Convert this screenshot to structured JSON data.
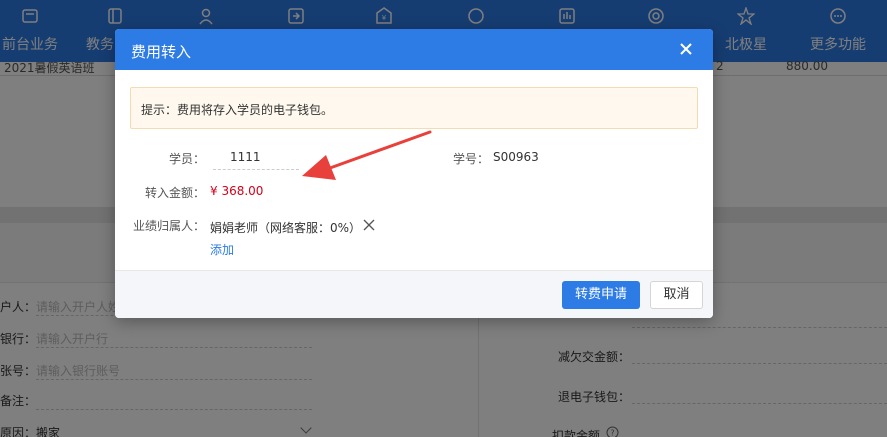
{
  "nav": {
    "items": [
      {
        "label": "前台业务",
        "icon": "front-desk-icon"
      },
      {
        "label": "教务",
        "icon": "book-icon"
      },
      {
        "label": "",
        "icon": "user-icon"
      },
      {
        "label": "",
        "icon": "login-icon"
      },
      {
        "label": "",
        "icon": "finance-icon"
      },
      {
        "label": "",
        "icon": "chat-icon"
      },
      {
        "label": "",
        "icon": "chart-icon"
      },
      {
        "label": "",
        "icon": "target-icon"
      },
      {
        "label": "北极星",
        "icon": "star-icon"
      },
      {
        "label": "更多功能",
        "icon": "more-icon"
      }
    ]
  },
  "background": {
    "class_name": "2021暑假英语班",
    "col_value": "2",
    "amount": "880.00",
    "left_form": [
      {
        "label": "户人：",
        "placeholder": "请输入开户人姓名"
      },
      {
        "label": "银行：",
        "placeholder": "请输入开户行"
      },
      {
        "label": "张号：",
        "placeholder": "请输入银行账号"
      },
      {
        "label": "备注：",
        "placeholder": ""
      },
      {
        "label": "原因：",
        "value": "搬家"
      }
    ],
    "right_form": [
      {
        "label": "减欠交金额："
      },
      {
        "label": "退电子钱包："
      },
      {
        "label": "扣款金额"
      }
    ]
  },
  "modal": {
    "title": "费用转入",
    "tip": "提示：费用将存入学员的电子钱包。",
    "student_label": "学员：",
    "student_value": "1111",
    "student_no_label": "学号：",
    "student_no_value": "S00963",
    "amount_label": "转入金额：",
    "amount_value": "¥ 368.00",
    "performance_label": "业绩归属人：",
    "performance_value": "娟娟老师（网络客服：0%）",
    "add_link": "添加",
    "submit_button": "转费申请",
    "cancel_button": "取消"
  },
  "colors": {
    "primary": "#2d7be5",
    "amount_red": "#d0021b",
    "annotation_arrow": "#e8403a"
  }
}
